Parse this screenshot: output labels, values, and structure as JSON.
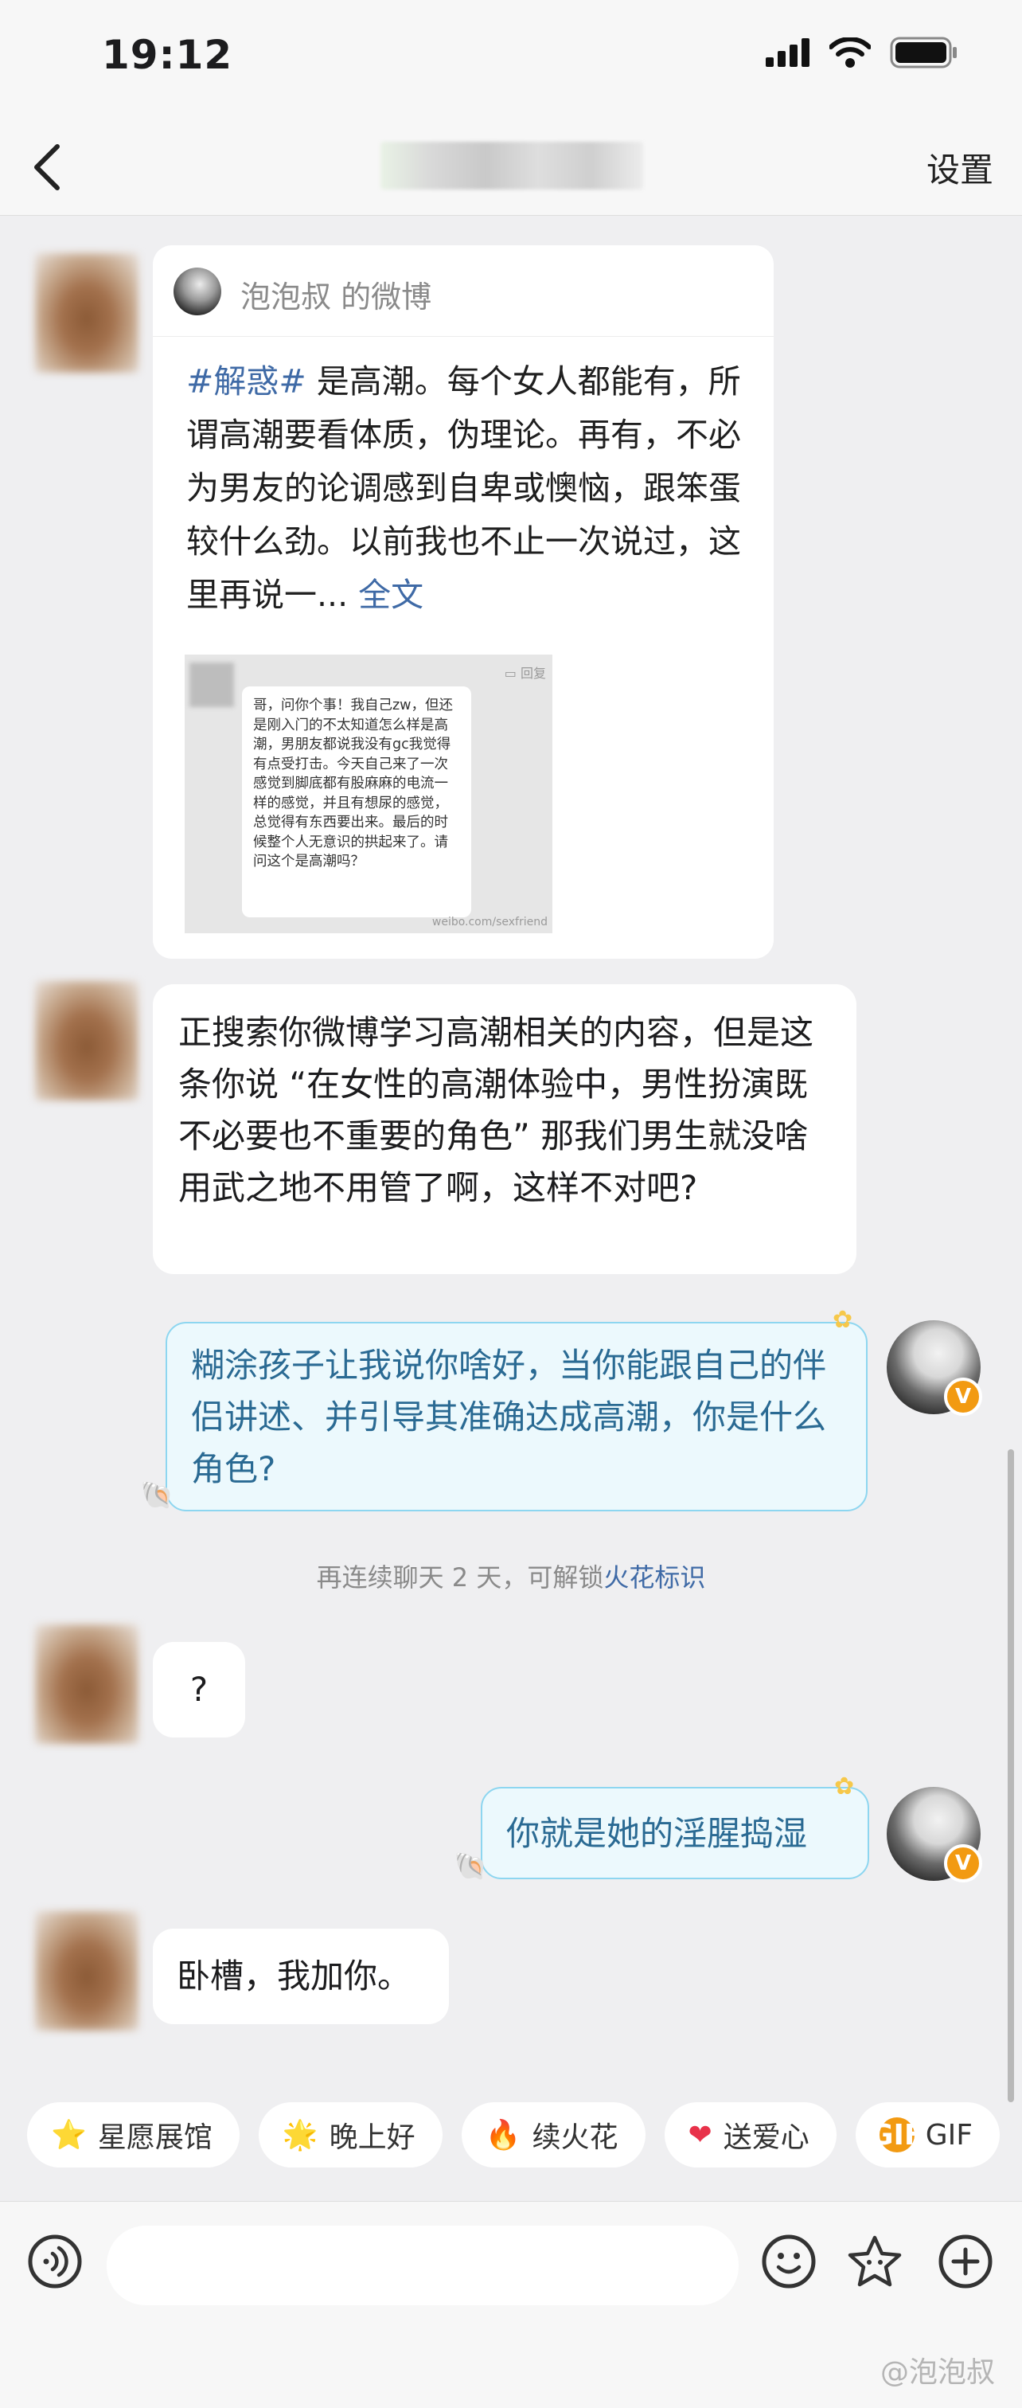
{
  "status_bar": {
    "time": "19:12"
  },
  "nav": {
    "settings_label": "设置"
  },
  "shared_card": {
    "author_line": "泡泡叔 的微博",
    "hashtag": "#解惑#",
    "text": " 是高潮。每个女人都能有，所谓高潮要看体质，伪理论。再有，不必为男友的论调感到自卑或懊恼，跟笨蛋较什么劲。以前我也不止一次说过，这里再说一... ",
    "full_text_link": "全文",
    "image_reply_label": "回复",
    "image_text": "哥，问你个事！我自己zw，但还是刚入门的不太知道怎么样是高潮，男朋友都说我没有gc我觉得有点受打击。今天自己来了一次感觉到脚底都有股麻麻的电流一样的感觉，并且有想尿的感觉，总觉得有东西要出来。最后的时候整个人无意识的拱起来了。请问这个是高潮吗？",
    "image_watermark": "weibo.com/sexfriend"
  },
  "messages": {
    "m2": "正搜索你微博学习高潮相关的内容，但是这条你说 “在女性的高潮体验中，男性扮演既不必要也不重要的角色” 那我们男生就没啥用武之地不用管了啊，这样不对吧?",
    "m3": "糊涂孩子让我说你啥好，当你能跟自己的伴侣讲述、并引导其准确达成高潮，你是什么角色?",
    "m4": "?",
    "m5": "你就是她的淫腥捣湿",
    "m6": "卧槽，我加你。"
  },
  "system_notice": {
    "text": "再连续聊天 2 天，可解锁",
    "highlight": "火花标识"
  },
  "quick_chips": [
    {
      "icon": "star-face-icon",
      "label": "星愿展馆"
    },
    {
      "icon": "smile-star-icon",
      "label": "晚上好"
    },
    {
      "icon": "fire-icon",
      "label": "续火花"
    },
    {
      "icon": "heart-icon",
      "label": "送爱心"
    },
    {
      "icon": "gif-icon",
      "label": "GIF"
    }
  ],
  "verified_badge": "V",
  "gif_icon_text": "GIF",
  "watermark": "@泡泡叔",
  "colors": {
    "accent_blue": "#3f6aa6",
    "my_bubble_bg": "#ecf9fd",
    "my_bubble_border": "#8dd6f0",
    "badge_orange": "#f29a12"
  }
}
